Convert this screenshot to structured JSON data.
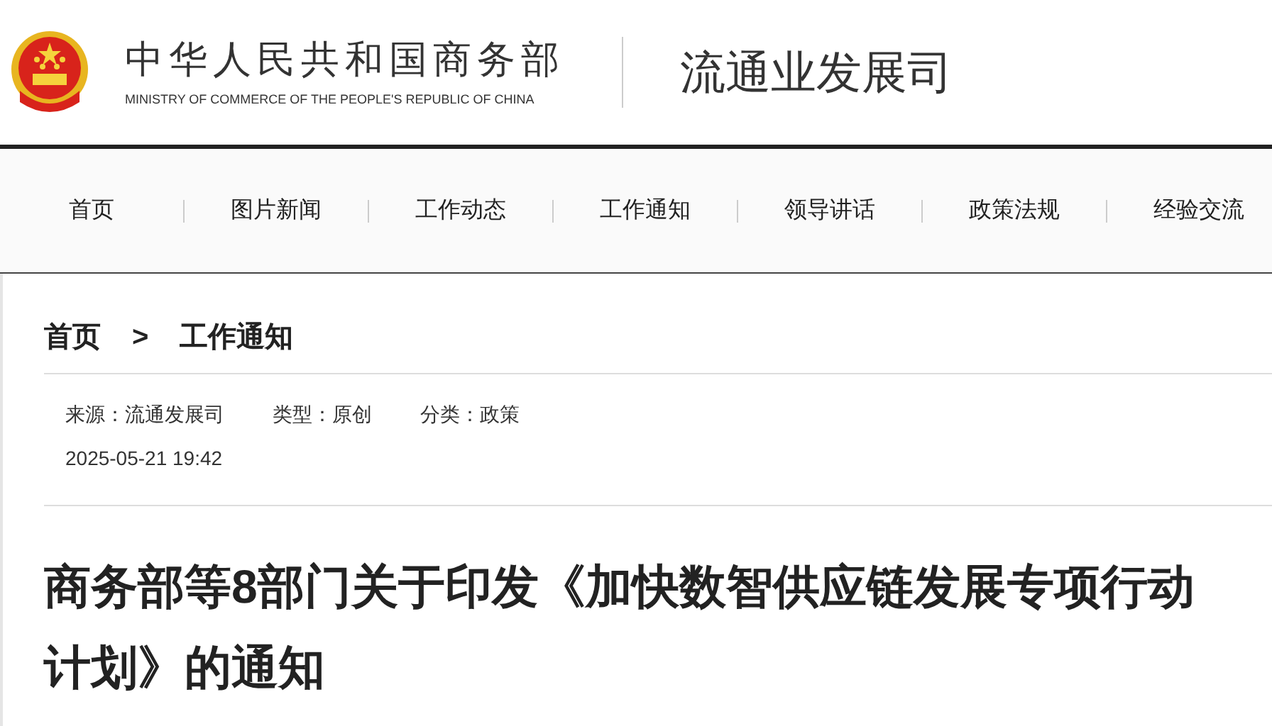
{
  "header": {
    "org_name": "中华人民共和国商务部",
    "org_name_en": "MINISTRY OF COMMERCE OF THE PEOPLE'S REPUBLIC OF CHINA",
    "department": "流通业发展司"
  },
  "nav": {
    "items": [
      "首页",
      "图片新闻",
      "工作动态",
      "工作通知",
      "领导讲话",
      "政策法规",
      "经验交流"
    ]
  },
  "breadcrumb": {
    "items": [
      "首页",
      "工作通知"
    ],
    "separator": ">"
  },
  "meta": {
    "fields": [
      "来源：流通发展司",
      "类型：原创",
      "分类：政策"
    ],
    "date": "2025-05-21 19:42"
  },
  "article": {
    "title": "商务部等8部门关于印发《加快数智供应链发展专项行动计划》的通知"
  }
}
